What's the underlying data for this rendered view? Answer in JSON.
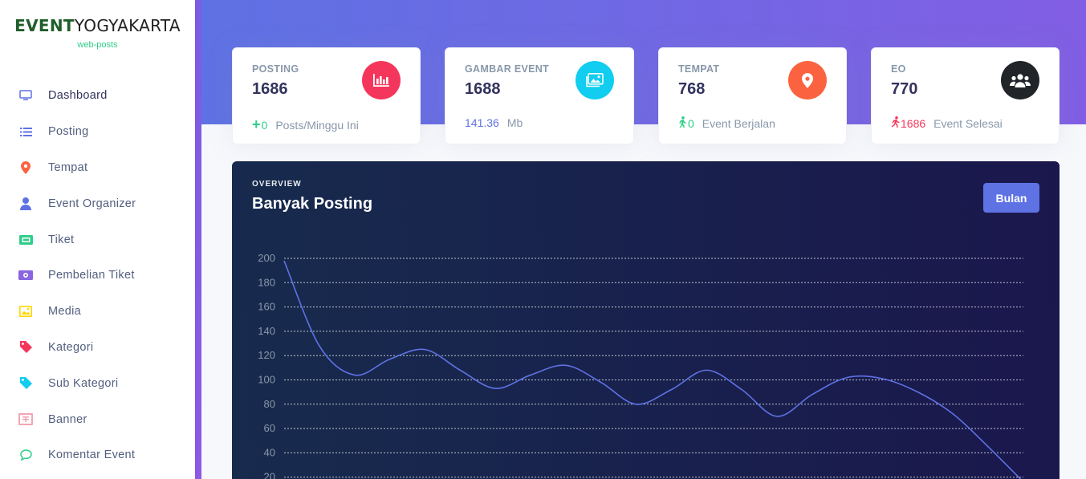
{
  "brand": {
    "logo_strong": "EVENT",
    "logo_light": "YOGYAKARTA",
    "subtitle": "web-posts"
  },
  "sidebar": {
    "items": [
      {
        "label": "Dashboard",
        "icon": "monitor-icon",
        "color": "#5e72e4"
      },
      {
        "label": "Posting",
        "icon": "list-icon",
        "color": "#5e72e4"
      },
      {
        "label": "Tempat",
        "icon": "map-pin-icon",
        "color": "#fb6340"
      },
      {
        "label": "Event Organizer",
        "icon": "user-icon",
        "color": "#5e72e4"
      },
      {
        "label": "Tiket",
        "icon": "ticket-icon",
        "color": "#2dce89"
      },
      {
        "label": "Pembelian Tiket",
        "icon": "money-icon",
        "color": "#8965e0"
      },
      {
        "label": "Media",
        "icon": "image-icon",
        "color": "#ffd600"
      },
      {
        "label": "Kategori",
        "icon": "tag-icon",
        "color": "#f5365c"
      },
      {
        "label": "Sub Kategori",
        "icon": "tag-icon",
        "color": "#11cdef"
      },
      {
        "label": "Banner",
        "icon": "banner-icon",
        "color": "#f3a4b5"
      },
      {
        "label": "Komentar Event",
        "icon": "chat-bubble-icon",
        "color": "#2dce89"
      }
    ]
  },
  "stats": [
    {
      "title": "POSTING",
      "value": "1686",
      "icon": "chart-bar-icon",
      "icon_bg": "#f5365c",
      "foot_icon": "plus-icon",
      "foot_value": "0",
      "foot_color": "#2dce89",
      "foot_text": "Posts/Minggu Ini"
    },
    {
      "title": "GAMBAR EVENT",
      "value": "1688",
      "icon": "images-icon",
      "icon_bg": "#11cdef",
      "foot_icon": "",
      "foot_value": "141.36",
      "foot_color": "#5e72e4",
      "foot_text": "Mb"
    },
    {
      "title": "TEMPAT",
      "value": "768",
      "icon": "map-pin-icon",
      "icon_bg": "#fb6340",
      "foot_icon": "walking-icon",
      "foot_value": "0",
      "foot_color": "#2dce89",
      "foot_text": "Event Berjalan"
    },
    {
      "title": "EO",
      "value": "770",
      "icon": "users-icon",
      "icon_bg": "#212529",
      "foot_icon": "running-icon",
      "foot_value": "1686",
      "foot_color": "#f5365c",
      "foot_text": "Event Selesai"
    }
  ],
  "chart_card": {
    "overline": "OVERVIEW",
    "title": "Banyak Posting",
    "button_label": "Bulan"
  },
  "chart_data": {
    "type": "line",
    "title": "Banyak Posting",
    "ylim": [
      0,
      200
    ],
    "y_ticks": [
      20,
      40,
      60,
      80,
      100,
      120,
      140,
      160,
      180,
      200
    ],
    "grid": true,
    "series": [
      {
        "values": [
          198,
          128,
          104,
          117,
          125,
          108,
          93,
          104,
          112,
          98,
          80,
          92,
          108,
          92,
          70,
          88,
          102,
          101,
          90,
          72,
          45,
          16
        ]
      }
    ],
    "line_color": "#5e72e4"
  }
}
